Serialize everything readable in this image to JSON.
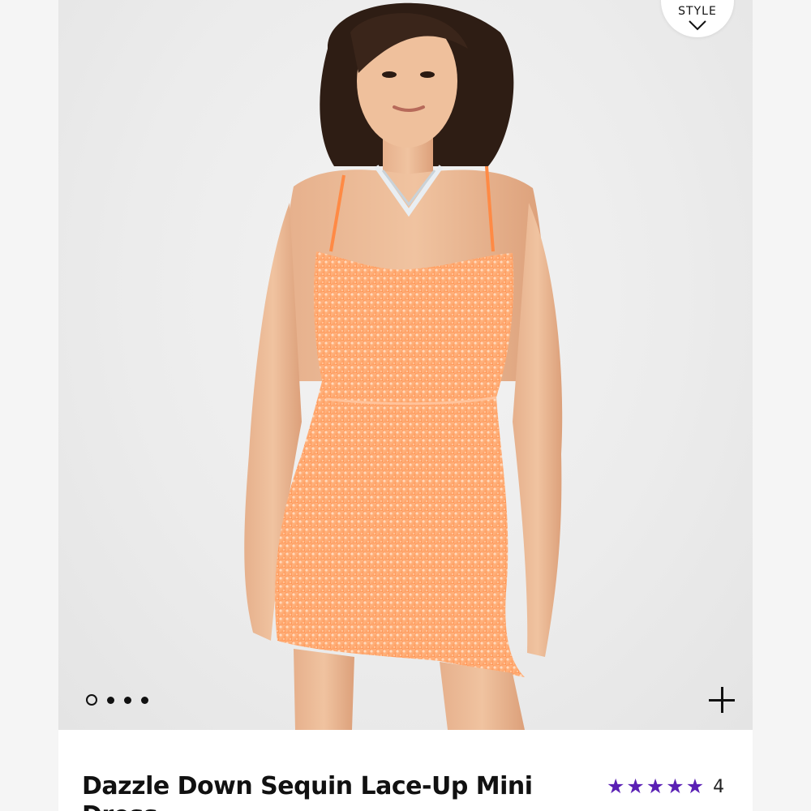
{
  "badge": {
    "text": "STYLE"
  },
  "carousel": {
    "dot_count": 4,
    "active_index": 0
  },
  "product": {
    "title": "Dazzle Down Sequin Lace-Up Mini Dress",
    "rating": {
      "stars": 5,
      "count": "4"
    }
  },
  "colors": {
    "dress": "#ffa065",
    "star": "#5a20b4",
    "background": "#ececec"
  },
  "icons": {
    "badge_chevron": "chevron-down-icon",
    "zoom": "plus-icon",
    "star": "star-icon"
  }
}
